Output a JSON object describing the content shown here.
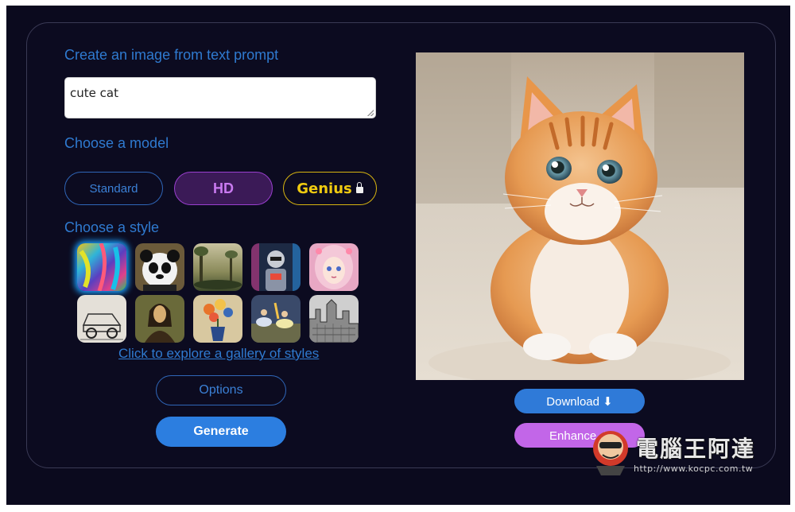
{
  "titles": {
    "create": "Create an image from text prompt",
    "model": "Choose a model",
    "style": "Choose a style"
  },
  "prompt": {
    "value": "cute cat"
  },
  "models": {
    "standard": "Standard",
    "hd": "HD",
    "genius": "Genius"
  },
  "styles": [
    {
      "name": "abstract-colorful",
      "selected": true
    },
    {
      "name": "panda"
    },
    {
      "name": "landscape-painting"
    },
    {
      "name": "robot"
    },
    {
      "name": "anime-girl"
    },
    {
      "name": "car-sketch"
    },
    {
      "name": "mona-lisa"
    },
    {
      "name": "flower-still-life"
    },
    {
      "name": "ballet-dancers"
    },
    {
      "name": "city-sketch"
    }
  ],
  "gallery_link": "Click to explore a gallery of styles",
  "buttons": {
    "options": "Options",
    "generate": "Generate",
    "download": "Download ⬇",
    "enhance": "Enhance ✦"
  },
  "watermark": {
    "title": "電腦王阿達",
    "url": "http://www.kocpc.com.tw"
  },
  "colors": {
    "background": "#0b0a1e",
    "accent": "#2f7ad0",
    "hd": "#9a3fcf",
    "genius": "#f0cb10",
    "enhance": "#c266e8"
  }
}
